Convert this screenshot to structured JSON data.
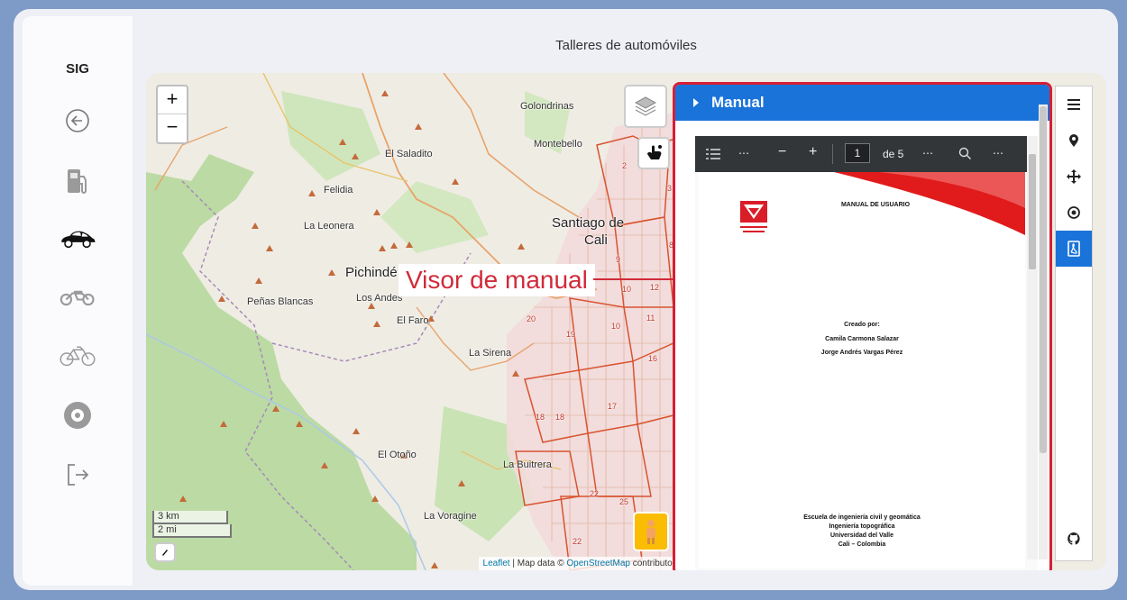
{
  "sidebar": {
    "brand": "SIG",
    "items": [
      {
        "icon": "back-arrow-icon"
      },
      {
        "icon": "fuel-pump-icon"
      },
      {
        "icon": "car-icon",
        "active": true
      },
      {
        "icon": "motorcycle-icon"
      },
      {
        "icon": "bicycle-icon"
      },
      {
        "icon": "tire-icon"
      },
      {
        "icon": "logout-icon"
      }
    ]
  },
  "header": {
    "title": "Talleres de automóviles"
  },
  "map": {
    "zoom_in": "+",
    "zoom_out": "−",
    "places": [
      "Golondrinas",
      "Montebello",
      "El Saladito",
      "Felidia",
      "La Leonera",
      "Santiago de",
      "Cali",
      "Pichindé",
      "Peñas Blancas",
      "Los Andes",
      "El Faro",
      "La Sirena",
      "El Otoño",
      "La Buitrera",
      "La Voragine"
    ],
    "comuna_numbers": [
      "2",
      "3",
      "9",
      "10",
      "11",
      "10",
      "12",
      "8",
      "19",
      "20",
      "16",
      "17",
      "18",
      "18",
      "22",
      "22",
      "25"
    ],
    "annotation": "Visor de manual",
    "scale_km": "3 km",
    "scale_mi": "2 mi",
    "attribution": {
      "leaflet": "Leaflet",
      "mid": " | Map data © ",
      "osm": "OpenStreetMap",
      "end": " contributors"
    }
  },
  "panel": {
    "title": "Manual",
    "pdf": {
      "page_value": "1",
      "page_total": "de 5",
      "page_title": "MANUAL DE USUARIO",
      "logo_text": "Universidad del Valle",
      "created_by": "Creado por:",
      "authors": [
        "Camila Carmona Salazar",
        "Jorge Andrés Vargas Pérez"
      ],
      "footer": [
        "Escuela de ingeniería civil y geomática",
        "Ingeniería topográfica",
        "Universidad del Valle",
        "Cali – Colombia"
      ]
    }
  },
  "sidebar_tabs": [
    "menu-icon",
    "location-pin-icon",
    "move-icon",
    "target-icon",
    "pdf-icon",
    "github-icon"
  ],
  "colors": {
    "accent": "#1a73d9",
    "highlight": "#d51f36"
  }
}
